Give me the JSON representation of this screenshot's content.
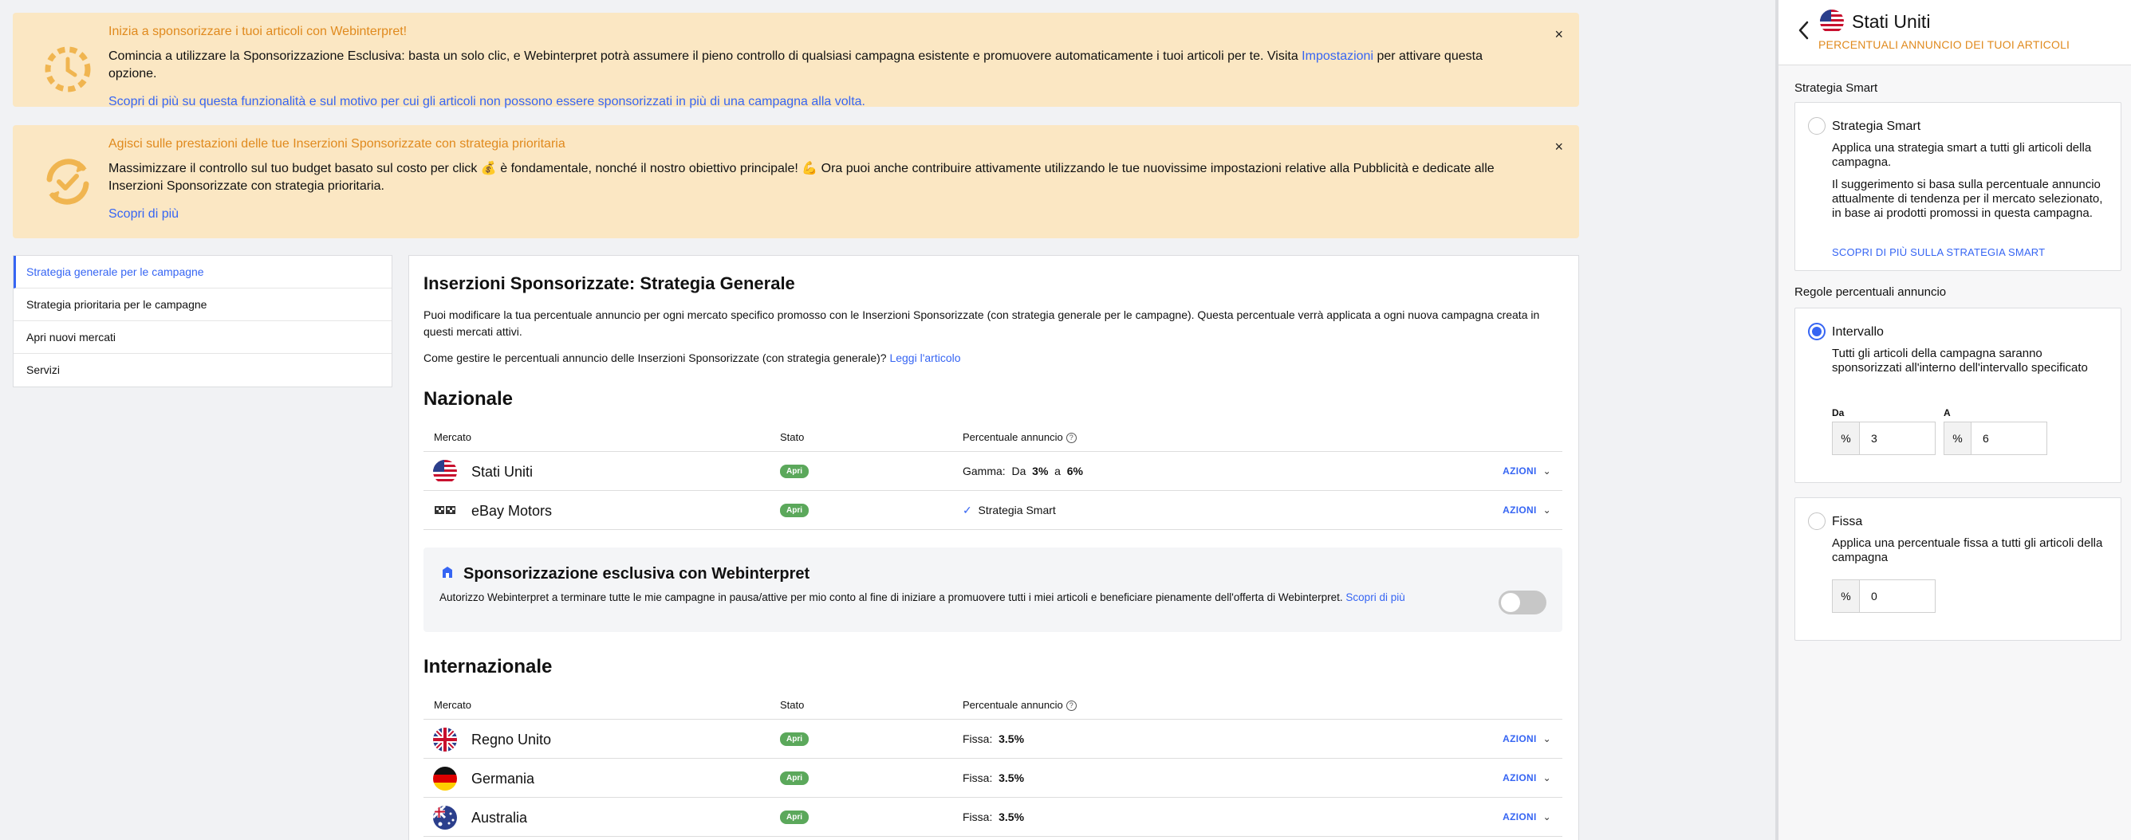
{
  "banner1": {
    "title": "Inizia a sponsorizzare i tuoi articoli con Webinterpret!",
    "text_before": "Comincia a utilizzare la Sponsorizzazione Esclusiva: basta un solo clic, e Webinterpret potrà assumere il pieno controllo di qualsiasi campagna esistente e promuovere automaticamente i tuoi articoli per te. Visita ",
    "text_link": "Impostazioni",
    "text_after": " per attivare questa opzione.",
    "link": "Scopri di più su questa funzionalità e sul motivo per cui gli articoli non possono essere sponsorizzati in più di una campagna alla volta.",
    "close": "×"
  },
  "banner2": {
    "title": "Agisci sulle prestazioni delle tue Inserzioni Sponsorizzate con strategia prioritaria",
    "text": "Massimizzare il controllo sul tuo budget basato sul costo per click 💰 è fondamentale, nonché il nostro obiettivo principale! 💪 Ora puoi anche contribuire attivamente utilizzando le tue nuovissime impostazioni relative alla Pubblicità e dedicate alle Inserzioni Sponsorizzate con strategia prioritaria.",
    "link": "Scopri di più",
    "close": "×"
  },
  "nav": {
    "items": [
      {
        "label": "Strategia generale per le campagne"
      },
      {
        "label": "Strategia prioritaria per le campagne"
      },
      {
        "label": "Apri nuovi mercati"
      },
      {
        "label": "Servizi"
      }
    ]
  },
  "content": {
    "title": "Inserzioni Sponsorizzate: Strategia Generale",
    "intro": "Puoi modificare la tua percentuale annuncio per ogni mercato specifico promosso con le Inserzioni Sponsorizzate (con strategia generale per le campagne). Questa percentuale verrà applicata a ogni nuova campagna creata in questi mercati attivi.",
    "howto": "Come gestire le percentuali annuncio delle Inserzioni Sponsorizzate (con strategia generale)? ",
    "howto_link": "Leggi l'articolo",
    "headers": {
      "market": "Mercato",
      "status": "Stato",
      "pct": "Percentuale annuncio"
    },
    "national_title": "Nazionale",
    "national": [
      {
        "name": "Stati Uniti",
        "status": "Apri",
        "pct_label": "Gamma:",
        "pct_from_label": "Da",
        "pct_from": "3%",
        "pct_to_label": "a",
        "pct_to": "6%",
        "actions": "AZIONI"
      },
      {
        "name": "eBay Motors",
        "status": "Apri",
        "check": "✓",
        "pct_label": "Strategia Smart",
        "actions": "AZIONI"
      }
    ],
    "exclusive": {
      "title": "Sponsorizzazione esclusiva con Webinterpret",
      "text": "Autorizzo Webinterpret a terminare tutte le mie campagne in pausa/attive per mio conto al fine di iniziare a promuovere tutti i miei articoli e beneficiare pienamente dell'offerta di Webinterpret. ",
      "link": "Scopri di più",
      "enabled": false
    },
    "international_title": "Internazionale",
    "international": [
      {
        "name": "Regno Unito",
        "status": "Apri",
        "pct_label": "Fissa:",
        "pct_value": "3.5%",
        "actions": "AZIONI"
      },
      {
        "name": "Germania",
        "status": "Apri",
        "pct_label": "Fissa:",
        "pct_value": "3.5%",
        "actions": "AZIONI"
      },
      {
        "name": "Australia",
        "status": "Apri",
        "pct_label": "Fissa:",
        "pct_value": "3.5%",
        "actions": "AZIONI"
      }
    ]
  },
  "side": {
    "title": "Stati Uniti",
    "subtitle": "PERCENTUALI ANNUNCIO DEI TUOI ARTICOLI",
    "smart_section": "Strategia Smart",
    "smart_option": {
      "title": "Strategia Smart",
      "desc1": "Applica una strategia smart a tutti gli articoli della campagna.",
      "desc2": "Il suggerimento si basa sulla percentuale annuncio attualmente di tendenza per il mercato selezionato, in base ai prodotti promossi in questa campagna.",
      "link": "SCOPRI DI PIÙ SULLA STRATEGIA SMART",
      "selected": false
    },
    "rules_section": "Regole percentuali annuncio",
    "range_option": {
      "title": "Intervallo",
      "desc": "Tutti gli articoli della campagna saranno sponsorizzati all'interno dell'intervallo specificato",
      "from_label": "Da",
      "to_label": "A",
      "prefix": "%",
      "from_value": "3",
      "to_value": "6",
      "selected": true
    },
    "fixed_option": {
      "title": "Fissa",
      "desc": "Applica una percentuale fissa a tutti gli articoli della campagna",
      "prefix": "%",
      "value": "0",
      "selected": false
    }
  },
  "colors": {
    "banner_bg": "#fbe7c3",
    "banner_title": "#e08a1e",
    "link": "#3665f3",
    "badge": "#5ba85b"
  }
}
